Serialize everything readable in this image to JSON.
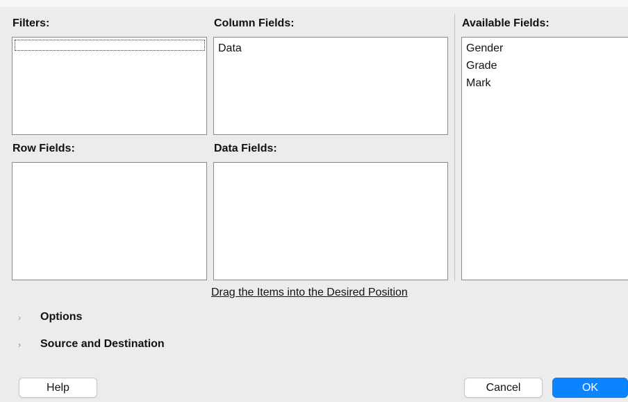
{
  "filters": {
    "label": "Filters:",
    "items": []
  },
  "column_fields": {
    "label": "Column Fields:",
    "items": [
      "Data"
    ]
  },
  "row_fields": {
    "label": "Row Fields:",
    "items": []
  },
  "data_fields": {
    "label": "Data Fields:",
    "items": []
  },
  "available_fields": {
    "label": "Available Fields:",
    "items": [
      "Gender",
      "Grade",
      "Mark"
    ]
  },
  "hint": "Drag the Items into the Desired Position",
  "expanders": {
    "options": {
      "label": "Options",
      "icon": "chevron-right-icon"
    },
    "source_destination": {
      "label": "Source and Destination",
      "icon": "chevron-right-icon"
    }
  },
  "buttons": {
    "help": "Help",
    "cancel": "Cancel",
    "ok": "OK"
  },
  "colors": {
    "primary": "#0a84ff",
    "dialog_bg": "#ececec"
  }
}
